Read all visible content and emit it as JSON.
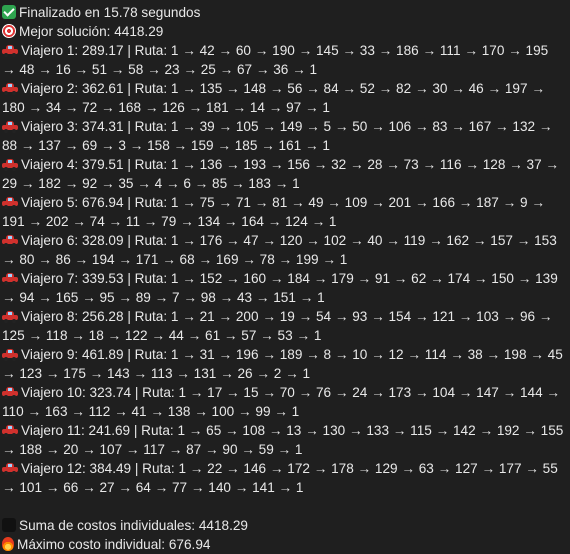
{
  "status": {
    "finished_text": "Finalizado en 15.78 segundos"
  },
  "best": {
    "label": "Mejor solución: 4418.29"
  },
  "travelers": [
    {
      "text": "Viajero 1: 289.17 | Ruta: 1 → 42 → 60 → 190 → 145 → 33 → 186 → 111 → 170 → 195 → 48 → 16 → 51 → 58 → 23 → 25 → 67 → 36 → 1"
    },
    {
      "text": "Viajero 2: 362.61 | Ruta: 1 → 135 → 148 → 56 → 84 → 52 → 82 → 30 → 46 → 197 → 180 → 34 → 72 → 168 → 126 → 181 → 14 → 97 → 1"
    },
    {
      "text": "Viajero 3: 374.31 | Ruta: 1 → 39 → 105 → 149 → 5 → 50 → 106 → 83 → 167 → 132 → 88 → 137 → 69 → 3 → 158 → 159 → 185 → 161 → 1"
    },
    {
      "text": "Viajero 4: 379.51 | Ruta: 1 → 136 → 193 → 156 → 32 → 28 → 73 → 116 → 128 → 37 → 29 → 182 → 92 → 35 → 4 → 6 → 85 → 183 → 1"
    },
    {
      "text": "Viajero 5: 676.94 | Ruta: 1 → 75 → 71 → 81 → 49 → 109 → 201 → 166 → 187 → 9 → 191 → 202 → 74 → 11 → 79 → 134 → 164 → 124 → 1"
    },
    {
      "text": "Viajero 6: 328.09 | Ruta: 1 → 176 → 47 → 120 → 102 → 40 → 119 → 162 → 157 → 153 → 80 → 86 → 194 → 171 → 68 → 169 → 78 → 199 → 1"
    },
    {
      "text": "Viajero 7: 339.53 | Ruta: 1 → 152 → 160 → 184 → 179 → 91 → 62 → 174 → 150 → 139 → 94 → 165 → 95 → 89 → 7 → 98 → 43 → 151 → 1"
    },
    {
      "text": "Viajero 8: 256.28 | Ruta: 1 → 21 → 200 → 19 → 54 → 93 → 154 → 121 → 103 → 96 → 125 → 118 → 18 → 122 → 44 → 61 → 57 → 53 → 1"
    },
    {
      "text": "Viajero 9: 461.89 | Ruta: 1 → 31 → 196 → 189 → 8 → 10 → 12 → 114 → 38 → 198 → 45 → 123 → 175 → 143 → 113 → 131 → 26 → 2 → 1"
    },
    {
      "text": "Viajero 10: 323.74 | Ruta: 1 → 17 → 15 → 70 → 76 → 24 → 173 → 104 → 147 → 144 → 110 → 163 → 112 → 41 → 138 → 100 → 99 → 1"
    },
    {
      "text": "Viajero 11: 241.69 | Ruta: 1 → 65 → 108 → 13 → 130 → 133 → 115 → 142 → 192 → 155 → 188 → 20 → 107 → 117 → 87 → 90 → 59 → 1"
    },
    {
      "text": "Viajero 12: 384.49 | Ruta: 1 → 22 → 146 → 172 → 178 → 129 → 63 → 127 → 177 → 55 → 101 → 66 → 27 → 64 → 77 → 140 → 141 → 1"
    }
  ],
  "summary": {
    "sum_label": "Suma de costos individuales: 4418.29",
    "max_label": "Máximo costo individual: 676.94"
  },
  "icons": {
    "status": "check-icon",
    "best": "target-icon",
    "traveler": "car-icon",
    "sum": "sum-icon",
    "max": "fire-icon"
  }
}
